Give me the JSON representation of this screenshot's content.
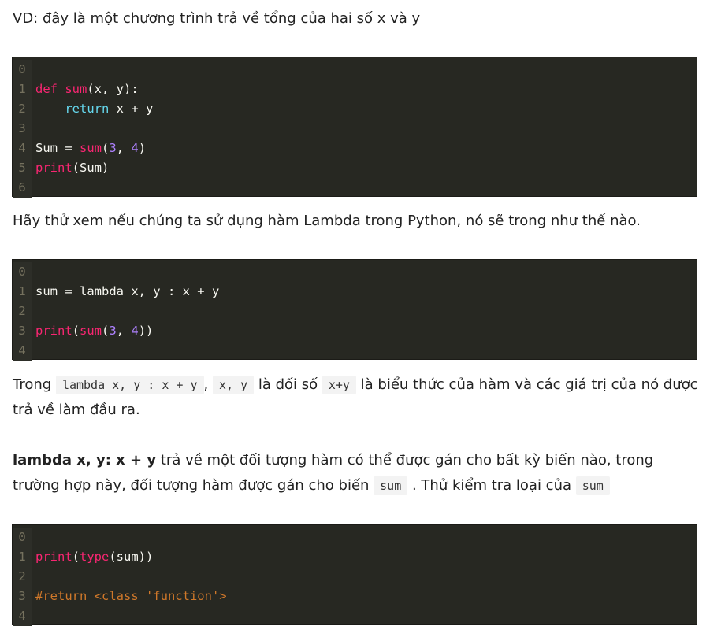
{
  "p1": "VD: đây là một chương trình trả về tổng của hai số x và y",
  "p2": "Hãy thử xem nếu chúng ta sử dụng hàm Lambda trong Python, nó sẽ trong như thế nào.",
  "p3": {
    "t1": "Trong ",
    "c1": "lambda x, y : x + y",
    "t2": ", ",
    "c2": "x, y",
    "t3": " là đối số ",
    "c3": "x+y",
    "t4": " là biểu thức của hàm và các giá trị của nó được trả về làm đầu ra."
  },
  "p4": {
    "b": "lambda x, y: x + y",
    "t1": " trả về một đối tượng hàm có thể được gán cho bất kỳ biến nào, trong trường hợp này, đối tượng hàm được gán cho biến ",
    "c1": "sum",
    "t2": " . Thử kiểm tra loại của ",
    "c2": "sum"
  },
  "block1": {
    "nums": [
      "0",
      "1",
      "2",
      "3",
      "4",
      "5",
      "6"
    ],
    "l1": {
      "kw": "def",
      "fn": "sum",
      "rest": "(x, y):"
    },
    "l2": {
      "indent": "    ",
      "kw": "return",
      "rest": " x + y"
    },
    "l4": {
      "a": "Sum = ",
      "fn": "sum",
      "b": "(",
      "n1": "3",
      "c": ", ",
      "n2": "4",
      "d": ")"
    },
    "l5": {
      "fn": "print",
      "rest": "(Sum)"
    }
  },
  "block2": {
    "nums": [
      "0",
      "1",
      "2",
      "3",
      "4"
    ],
    "l1": {
      "text": "sum = lambda x, y : x + y"
    },
    "l3": {
      "fn1": "print",
      "a": "(",
      "fn2": "sum",
      "b": "(",
      "n1": "3",
      "c": ", ",
      "n2": "4",
      "d": "))"
    }
  },
  "block3": {
    "nums": [
      "0",
      "1",
      "2",
      "3",
      "4"
    ],
    "l1": {
      "fn1": "print",
      "a": "(",
      "fn2": "type",
      "b": "(sum))"
    },
    "l3": {
      "comment": "#return <class 'function'>"
    }
  }
}
